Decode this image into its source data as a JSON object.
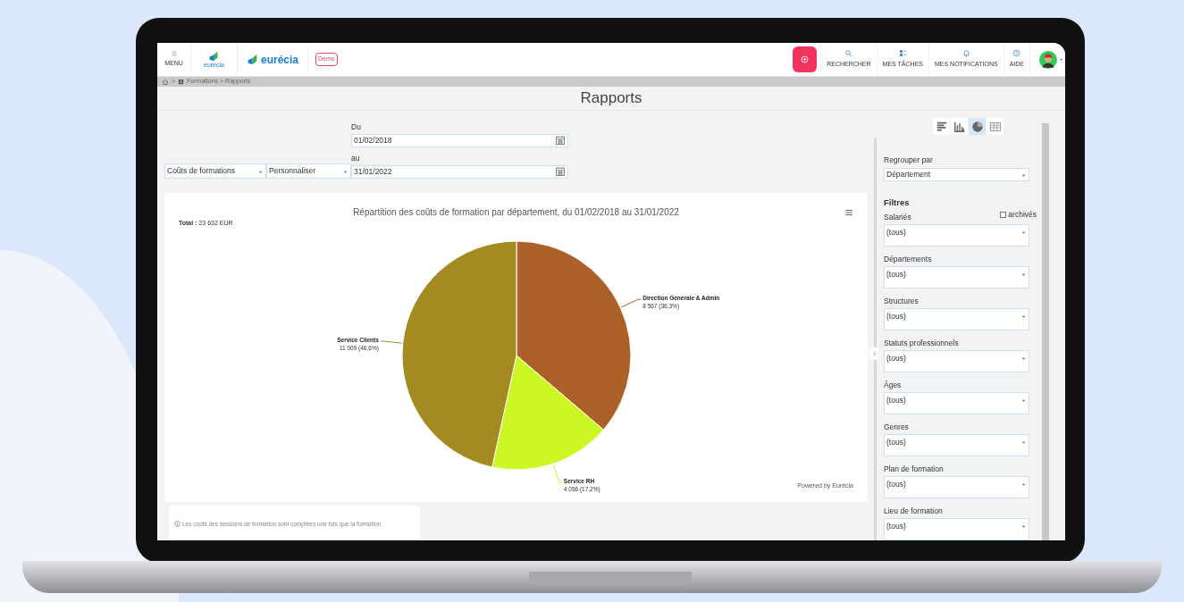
{
  "header": {
    "menu_label": "MENU",
    "logo_small_text": "eurécia",
    "logo_text": "eurécia",
    "badge": "Demo",
    "nav": [
      {
        "kind": "search",
        "label": "RECHERCHER"
      },
      {
        "kind": "tasks",
        "label": "MES TÂCHES"
      },
      {
        "kind": "notifications",
        "label": "MES NOTIFICATIONS"
      },
      {
        "kind": "help",
        "label": "AIDE"
      }
    ]
  },
  "breadcrumb": {
    "separator": ">",
    "path": "Formations > Rapports"
  },
  "page_title": "Rapports",
  "period": {
    "from_label": "Du",
    "from_value": "01/02/2018",
    "to_label": "au",
    "to_value": "31/01/2022",
    "report_select": "Coûts de formations",
    "period_select": "Personnaliser"
  },
  "chart_card": {
    "total": "**Total :** 23 632 EUR",
    "credit": "Powered by Eurécia",
    "chart_data": {
      "type": "pie",
      "title": "Répartition des coûts de formation par département, du 01/02/2018 au 31/01/2022",
      "categories": [
        "Direction Générale & Admin",
        "Service RH",
        "Service Clients"
      ],
      "values": [
        8567,
        4056,
        11009
      ],
      "colors": [
        "#ac6128",
        "#ccf724",
        "#a38a21"
      ],
      "value_labels": [
        "8 567 (36,3%)",
        "4 056 (17,2%)",
        "11 009 (46,6%)"
      ]
    }
  },
  "note": "Les coûts des sessions de formation sont comptées une fois que la formation.",
  "sidebar": {
    "chart_types": [
      {
        "kind": "hbar",
        "selected": false
      },
      {
        "kind": "bar",
        "selected": false
      },
      {
        "kind": "pie",
        "selected": true
      },
      {
        "kind": "table",
        "selected": false
      }
    ],
    "group_label": "Regrouper par",
    "group_value": "Département",
    "filters_title": "Filtres",
    "archived": {
      "label": "archivés",
      "checked": false
    },
    "filters": [
      {
        "label": "Salariés",
        "value": "(tous)"
      },
      {
        "label": "Départements",
        "value": "(tous)"
      },
      {
        "label": "Structures",
        "value": "(tous)"
      },
      {
        "label": "Statuts professionnels",
        "value": "(tous)"
      },
      {
        "label": "Âges",
        "value": "(tous)"
      },
      {
        "label": "Genres",
        "value": "(tous)"
      },
      {
        "label": "Plan de formation",
        "value": "(tous)"
      },
      {
        "label": "Lieu de formation",
        "value": "(tous)"
      }
    ]
  }
}
